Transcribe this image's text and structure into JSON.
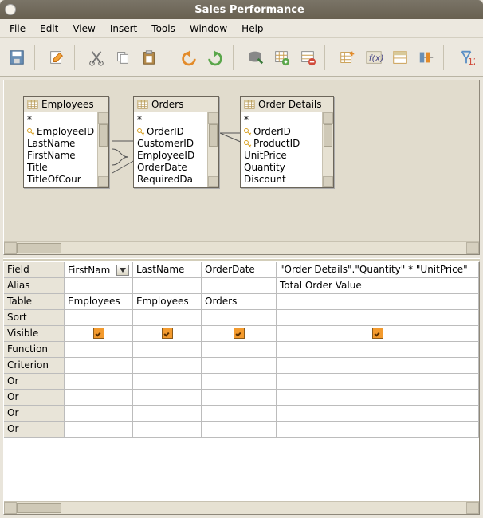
{
  "window": {
    "title": "Sales Performance"
  },
  "menu": {
    "file": "File",
    "edit": "Edit",
    "view": "View",
    "insert": "Insert",
    "tools": "Tools",
    "window": "Window",
    "help": "Help"
  },
  "tables": {
    "employees": {
      "title": "Employees",
      "fields": [
        "*",
        "EmployeeID",
        "LastName",
        "FirstName",
        "Title",
        "TitleOfCour"
      ],
      "keys": [
        "EmployeeID"
      ]
    },
    "orders": {
      "title": "Orders",
      "fields": [
        "*",
        "OrderID",
        "CustomerID",
        "EmployeeID",
        "OrderDate",
        "RequiredDa"
      ],
      "keys": [
        "OrderID"
      ]
    },
    "orderdetails": {
      "title": "Order Details",
      "fields": [
        "*",
        "OrderID",
        "ProductID",
        "UnitPrice",
        "Quantity",
        "Discount"
      ],
      "keys": [
        "OrderID",
        "ProductID"
      ]
    }
  },
  "gridRows": [
    "Field",
    "Alias",
    "Table",
    "Sort",
    "Visible",
    "Function",
    "Criterion",
    "Or",
    "Or",
    "Or",
    "Or"
  ],
  "columns": [
    {
      "field": "FirstNam",
      "alias": "",
      "table": "Employees",
      "sort": "",
      "visible": true,
      "function": "",
      "criterion": "",
      "or1": "",
      "or2": "",
      "or3": "",
      "or4": "",
      "dropdown": true
    },
    {
      "field": "LastName",
      "alias": "",
      "table": "Employees",
      "sort": "",
      "visible": true,
      "function": "",
      "criterion": "",
      "or1": "",
      "or2": "",
      "or3": "",
      "or4": ""
    },
    {
      "field": "OrderDate",
      "alias": "",
      "table": "Orders",
      "sort": "",
      "visible": true,
      "function": "",
      "criterion": "",
      "or1": "",
      "or2": "",
      "or3": "",
      "or4": ""
    },
    {
      "field": "\"Order Details\".\"Quantity\" * \"UnitPrice\"",
      "alias": "Total Order Value",
      "table": "",
      "sort": "",
      "visible": true,
      "function": "",
      "criterion": "",
      "or1": "",
      "or2": "",
      "or3": "",
      "or4": ""
    }
  ]
}
